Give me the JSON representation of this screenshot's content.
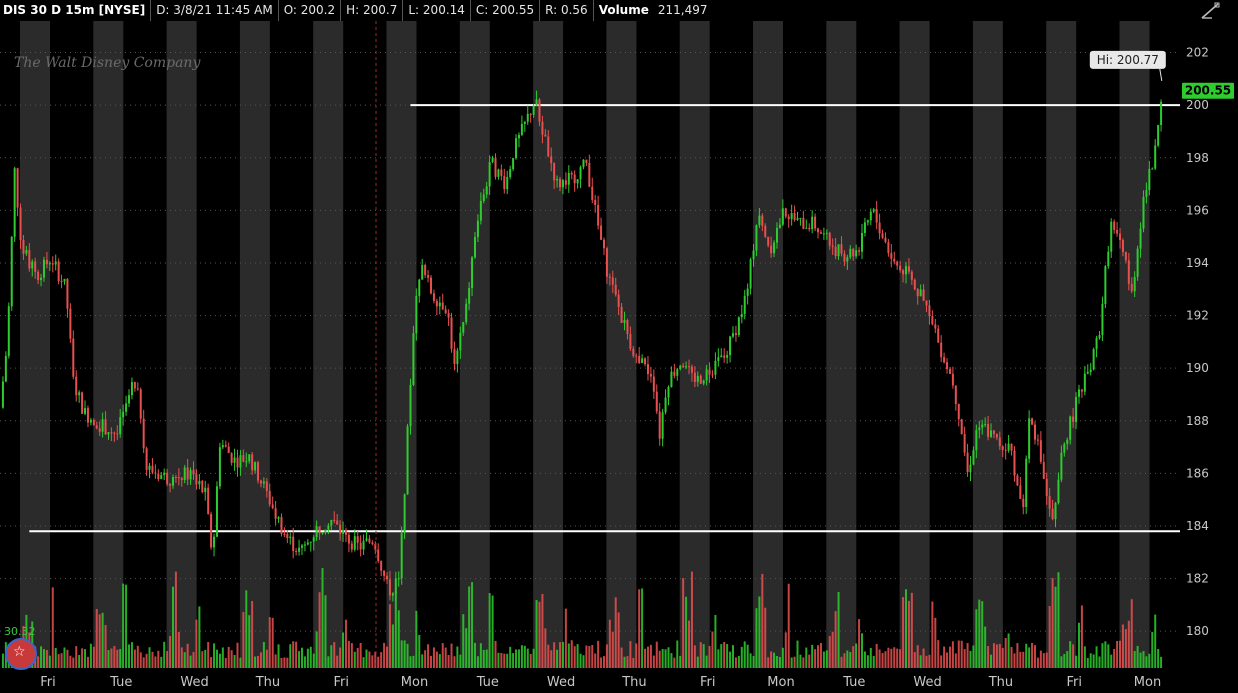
{
  "header": {
    "symbol": "DIS 30 D 15m [NYSE]",
    "date": "D: 3/8/21 11:45 AM",
    "open": "O: 200.2",
    "high": "H: 200.7",
    "low": "L: 200.14",
    "close": "C: 200.55",
    "range": "R: 0.56",
    "volume_label": "Volume",
    "volume_value": "211,497"
  },
  "watermark": "The Walt Disney Company",
  "volume_study_label": "30.32",
  "icons": {
    "drawing_tool": "trend-line-icon",
    "logo": "app-logo-icon"
  },
  "colors": {
    "up": "#2ecc2e",
    "down": "#e85050",
    "last_price_bg": "#2ecc2e",
    "session_band": "#2b2b2b",
    "level_line": "#ffffff"
  },
  "chart_data": {
    "type": "candlestick",
    "title": "",
    "x_tick_labels": [
      "Fri",
      "Tue",
      "Wed",
      "Thu",
      "Fri",
      "Mon",
      "Tue",
      "Wed",
      "Thu",
      "Fri",
      "Mon",
      "Tue",
      "Wed",
      "Thu",
      "Fri",
      "Mon"
    ],
    "y_ticks": [
      180,
      182,
      184,
      186,
      188,
      190,
      192,
      194,
      196,
      198,
      200,
      202
    ],
    "y_tick_labels": [
      "180",
      "182",
      "184",
      "186",
      "188",
      "190",
      "192",
      "194",
      "196",
      "198",
      "200",
      "202"
    ],
    "ylim": [
      178.6,
      203.2
    ],
    "last_price": "200.55",
    "last_price_value": 200.55,
    "high_marker": "Hi: 200.77",
    "high_value": 200.77,
    "horizontal_levels": [
      {
        "value": 200.0,
        "start_session": 5.6
      },
      {
        "value": 183.8,
        "start_session": 0.4
      }
    ],
    "price_path": [
      {
        "s": 0.0,
        "p": 188.5
      },
      {
        "s": 0.1,
        "p": 191.0
      },
      {
        "s": 0.2,
        "p": 197.5
      },
      {
        "s": 0.3,
        "p": 194.5
      },
      {
        "s": 0.5,
        "p": 193.5
      },
      {
        "s": 0.7,
        "p": 194.2
      },
      {
        "s": 0.9,
        "p": 193.0
      },
      {
        "s": 1.0,
        "p": 189.5
      },
      {
        "s": 1.15,
        "p": 188.3
      },
      {
        "s": 1.4,
        "p": 187.8
      },
      {
        "s": 1.6,
        "p": 187.5
      },
      {
        "s": 1.8,
        "p": 189.3
      },
      {
        "s": 1.9,
        "p": 188.8
      },
      {
        "s": 2.0,
        "p": 186.2
      },
      {
        "s": 2.3,
        "p": 185.8
      },
      {
        "s": 2.6,
        "p": 186.0
      },
      {
        "s": 2.8,
        "p": 185.2
      },
      {
        "s": 2.9,
        "p": 182.8
      },
      {
        "s": 3.0,
        "p": 187.2
      },
      {
        "s": 3.2,
        "p": 186.5
      },
      {
        "s": 3.4,
        "p": 186.6
      },
      {
        "s": 3.6,
        "p": 185.5
      },
      {
        "s": 3.75,
        "p": 184.5
      },
      {
        "s": 3.9,
        "p": 183.6
      },
      {
        "s": 4.1,
        "p": 183.0
      },
      {
        "s": 4.3,
        "p": 183.8
      },
      {
        "s": 4.5,
        "p": 184.3
      },
      {
        "s": 4.7,
        "p": 183.6
      },
      {
        "s": 4.9,
        "p": 183.2
      },
      {
        "s": 5.1,
        "p": 183.5
      },
      {
        "s": 5.3,
        "p": 181.5
      },
      {
        "s": 5.45,
        "p": 182.0
      },
      {
        "s": 5.55,
        "p": 187.0
      },
      {
        "s": 5.65,
        "p": 192.0
      },
      {
        "s": 5.75,
        "p": 193.8
      },
      {
        "s": 5.9,
        "p": 192.8
      },
      {
        "s": 6.1,
        "p": 192.3
      },
      {
        "s": 6.2,
        "p": 190.0
      },
      {
        "s": 6.35,
        "p": 192.0
      },
      {
        "s": 6.5,
        "p": 195.5
      },
      {
        "s": 6.7,
        "p": 197.8
      },
      {
        "s": 6.9,
        "p": 197.0
      },
      {
        "s": 7.0,
        "p": 198.2
      },
      {
        "s": 7.15,
        "p": 199.2
      },
      {
        "s": 7.3,
        "p": 200.2
      },
      {
        "s": 7.45,
        "p": 198.5
      },
      {
        "s": 7.6,
        "p": 197.0
      },
      {
        "s": 7.8,
        "p": 197.2
      },
      {
        "s": 8.0,
        "p": 197.8
      },
      {
        "s": 8.15,
        "p": 195.5
      },
      {
        "s": 8.3,
        "p": 193.5
      },
      {
        "s": 8.5,
        "p": 191.8
      },
      {
        "s": 8.7,
        "p": 190.2
      },
      {
        "s": 8.9,
        "p": 189.8
      },
      {
        "s": 9.0,
        "p": 187.5
      },
      {
        "s": 9.1,
        "p": 189.5
      },
      {
        "s": 9.3,
        "p": 190.3
      },
      {
        "s": 9.5,
        "p": 189.5
      },
      {
        "s": 9.7,
        "p": 190.0
      },
      {
        "s": 9.9,
        "p": 190.5
      },
      {
        "s": 10.1,
        "p": 192.0
      },
      {
        "s": 10.2,
        "p": 193.0
      },
      {
        "s": 10.35,
        "p": 196.2
      },
      {
        "s": 10.5,
        "p": 194.5
      },
      {
        "s": 10.7,
        "p": 196.0
      },
      {
        "s": 10.9,
        "p": 195.5
      },
      {
        "s": 11.1,
        "p": 195.5
      },
      {
        "s": 11.3,
        "p": 194.8
      },
      {
        "s": 11.5,
        "p": 194.3
      },
      {
        "s": 11.7,
        "p": 194.5
      },
      {
        "s": 11.9,
        "p": 196.0
      },
      {
        "s": 12.0,
        "p": 195.3
      },
      {
        "s": 12.2,
        "p": 194.0
      },
      {
        "s": 12.4,
        "p": 193.5
      },
      {
        "s": 12.6,
        "p": 192.5
      },
      {
        "s": 12.8,
        "p": 191.0
      },
      {
        "s": 13.0,
        "p": 189.5
      },
      {
        "s": 13.1,
        "p": 188.0
      },
      {
        "s": 13.2,
        "p": 186.0
      },
      {
        "s": 13.35,
        "p": 188.0
      },
      {
        "s": 13.6,
        "p": 187.2
      },
      {
        "s": 13.8,
        "p": 186.8
      },
      {
        "s": 13.95,
        "p": 184.5
      },
      {
        "s": 14.05,
        "p": 188.5
      },
      {
        "s": 14.2,
        "p": 186.5
      },
      {
        "s": 14.35,
        "p": 184.0
      },
      {
        "s": 14.5,
        "p": 187.0
      },
      {
        "s": 14.7,
        "p": 188.8
      },
      {
        "s": 14.9,
        "p": 190.2
      },
      {
        "s": 15.0,
        "p": 191.5
      },
      {
        "s": 15.15,
        "p": 195.5
      },
      {
        "s": 15.3,
        "p": 194.5
      },
      {
        "s": 15.45,
        "p": 193.0
      },
      {
        "s": 15.6,
        "p": 196.5
      },
      {
        "s": 15.75,
        "p": 198.0
      },
      {
        "s": 15.85,
        "p": 200.55
      }
    ]
  }
}
